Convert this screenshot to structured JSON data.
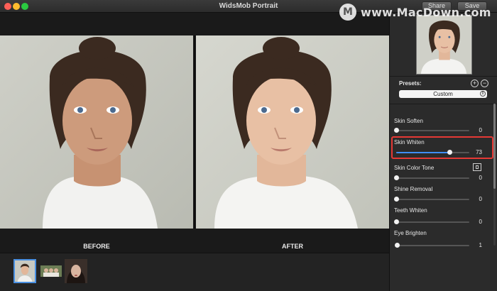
{
  "window": {
    "title": "WidsMob Portrait"
  },
  "toolbar": {
    "share_label": "Share",
    "save_label": "Save"
  },
  "watermark": {
    "text": "www.MacDown.com"
  },
  "preview": {
    "before_label": "BEFORE",
    "after_label": "AFTER"
  },
  "filmstrip": {
    "thumbnails": [
      "portrait-woman-selected",
      "group-photo",
      "woman-dark-hair"
    ]
  },
  "panel": {
    "presets_label": "Presets:",
    "preset_value": "Custom",
    "adjustments": [
      {
        "label": "Skin Soften",
        "value": "0",
        "level": 0
      },
      {
        "label": "Skin Whiten",
        "value": "73",
        "level": 0.73,
        "highlighted": true
      },
      {
        "label": "Skin Color Tone",
        "value": "0",
        "level": 0,
        "has_swatch": true
      },
      {
        "label": "Shine Removal",
        "value": "0",
        "level": 0
      },
      {
        "label": "Teeth Whiten",
        "value": "0",
        "level": 0
      },
      {
        "label": "Eye Brighten",
        "value": "1",
        "level": 0.01
      }
    ]
  },
  "colors": {
    "accent": "#3f8ef5",
    "highlight": "#e53935",
    "background": "#1b1b1b",
    "panel": "#2b2b2b"
  }
}
